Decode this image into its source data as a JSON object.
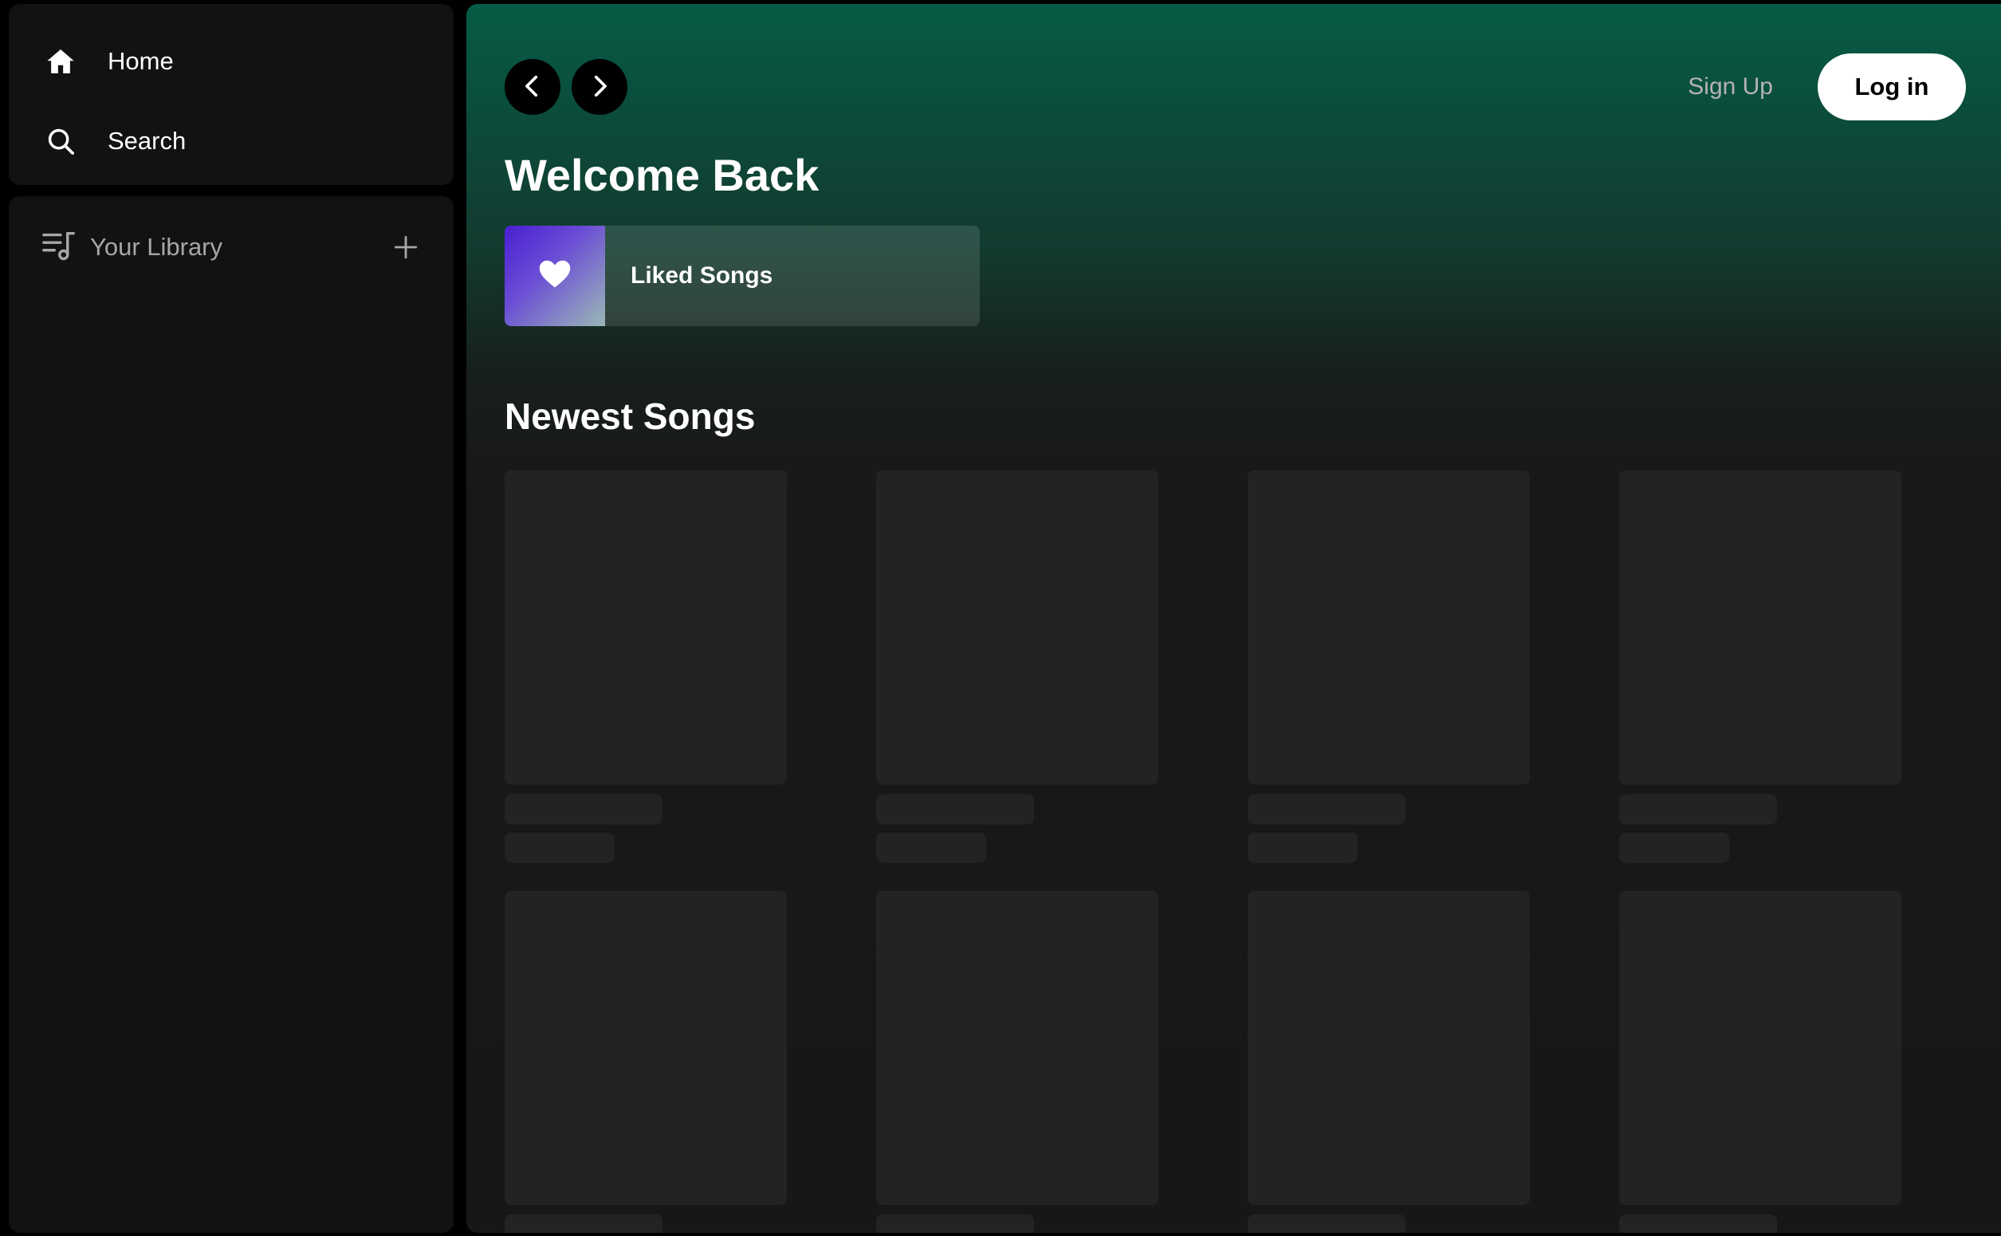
{
  "sidebar": {
    "nav": [
      {
        "label": "Home",
        "icon": "home-icon"
      },
      {
        "label": "Search",
        "icon": "search-icon"
      }
    ],
    "library": {
      "label": "Your Library",
      "icon": "library-icon",
      "add_icon": "plus-icon"
    }
  },
  "header": {
    "back_icon": "chevron-left-icon",
    "forward_icon": "chevron-right-icon",
    "signup_label": "Sign Up",
    "login_label": "Log in"
  },
  "main": {
    "welcome": "Welcome Back",
    "liked_songs": {
      "label": "Liked Songs",
      "icon": "heart-icon"
    },
    "section_title": "Newest Songs",
    "loading_cards": 8
  },
  "colors": {
    "background": "#000000",
    "panel": "#121212",
    "accent_green": "#065c45",
    "skeleton": "#232323",
    "liked_gradient_start": "#4a1fd1",
    "liked_gradient_end": "#9ab8b6"
  }
}
